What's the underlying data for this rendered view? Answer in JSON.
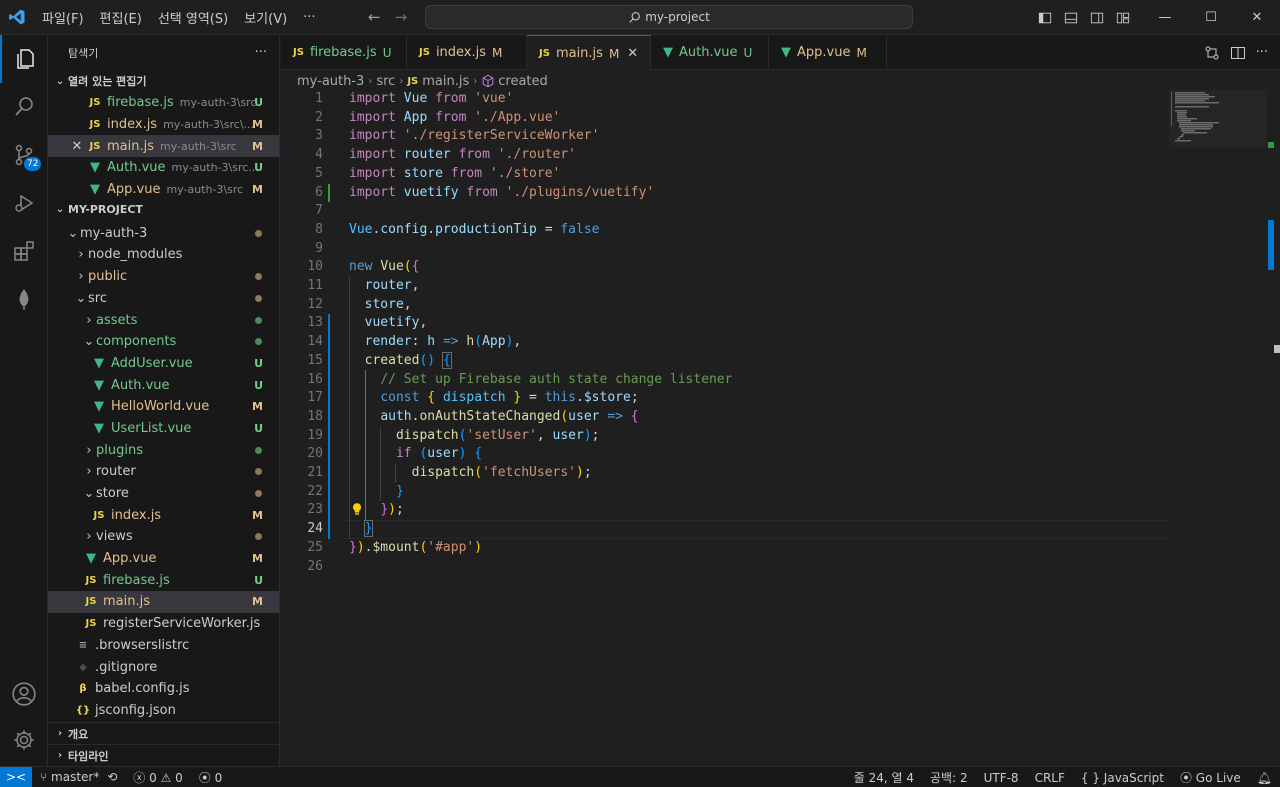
{
  "titlebar": {
    "menu": [
      "파일(F)",
      "편집(E)",
      "선택 영역(S)",
      "보기(V)",
      "···"
    ],
    "search": "my-project"
  },
  "activity": {
    "scm_badge": "72"
  },
  "sidebar": {
    "title": "탐색기",
    "more": "···",
    "open_editors_label": "열려 있는 편집기",
    "open_editors": [
      {
        "name": "firebase.js",
        "desc": "my-auth-3\\src",
        "status": "U",
        "type": "js"
      },
      {
        "name": "index.js",
        "desc": "my-auth-3\\src\\...",
        "status": "M",
        "type": "js"
      },
      {
        "name": "main.js",
        "desc": "my-auth-3\\src",
        "status": "M",
        "type": "js"
      },
      {
        "name": "Auth.vue",
        "desc": "my-auth-3\\src...",
        "status": "U",
        "type": "vue"
      },
      {
        "name": "App.vue",
        "desc": "my-auth-3\\src",
        "status": "M",
        "type": "vue"
      }
    ],
    "project_label": "MY-PROJECT",
    "tree": [
      {
        "name": "my-auth-3",
        "status": "dot"
      },
      {
        "name": "node_modules",
        "status": ""
      },
      {
        "name": "public",
        "status": "dot"
      },
      {
        "name": "src",
        "status": "dot"
      },
      {
        "name": "assets",
        "status": "dotg"
      },
      {
        "name": "components",
        "status": "dotg"
      },
      {
        "name": "AddUser.vue",
        "status": "U"
      },
      {
        "name": "Auth.vue",
        "status": "U"
      },
      {
        "name": "HelloWorld.vue",
        "status": "M"
      },
      {
        "name": "UserList.vue",
        "status": "U"
      },
      {
        "name": "plugins",
        "status": "dotg"
      },
      {
        "name": "router",
        "status": "dot"
      },
      {
        "name": "store",
        "status": "dot"
      },
      {
        "name": "index.js",
        "status": "M"
      },
      {
        "name": "views",
        "status": "dot"
      },
      {
        "name": "App.vue",
        "status": "M"
      },
      {
        "name": "firebase.js",
        "status": "U"
      },
      {
        "name": "main.js",
        "status": "M"
      },
      {
        "name": "registerServiceWorker.js",
        "status": ""
      },
      {
        "name": ".browserslistrc",
        "status": ""
      },
      {
        "name": ".gitignore",
        "status": ""
      },
      {
        "name": "babel.config.js",
        "status": ""
      },
      {
        "name": "jsconfig.json",
        "status": ""
      }
    ],
    "outline_label": "개요",
    "timeline_label": "타임라인"
  },
  "tabs": [
    {
      "name": "firebase.js",
      "status": "U",
      "type": "js"
    },
    {
      "name": "index.js",
      "status": "M",
      "type": "js"
    },
    {
      "name": "main.js",
      "status": "M",
      "type": "js"
    },
    {
      "name": "Auth.vue",
      "status": "U",
      "type": "vue"
    },
    {
      "name": "App.vue",
      "status": "M",
      "type": "vue"
    }
  ],
  "breadcrumbs": [
    "my-auth-3",
    "src",
    "main.js",
    "created"
  ],
  "editor": {
    "line_numbers": [
      "1",
      "2",
      "3",
      "4",
      "5",
      "6",
      "7",
      "8",
      "9",
      "10",
      "11",
      "12",
      "13",
      "14",
      "15",
      "16",
      "17",
      "18",
      "19",
      "20",
      "21",
      "22",
      "23",
      "24",
      "25",
      "26"
    ],
    "current_line": "24"
  },
  "statusbar": {
    "branch": "master*",
    "problems": "0",
    "warnings": "0",
    "ports": "0",
    "position": "줄 24, 열 4",
    "indent": "공백: 2",
    "encoding": "UTF-8",
    "eol": "CRLF",
    "language": "JavaScript",
    "golive": "Go Live"
  }
}
